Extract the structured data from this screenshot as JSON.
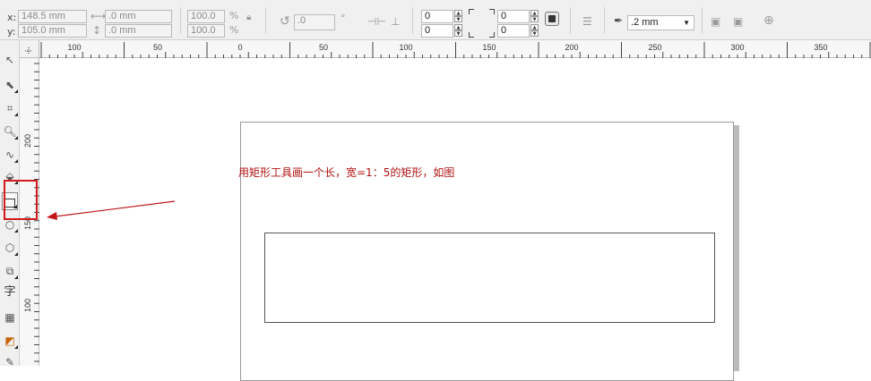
{
  "property_bar": {
    "x_label": "x:",
    "y_label": "y:",
    "x_value": "148.5 mm",
    "y_value": "105.0 mm",
    "width_value": ".0 mm",
    "height_value": ".0 mm",
    "scale_x": "100.0",
    "scale_y": "100.0",
    "percent": "%",
    "rotation_value": ".0",
    "degree": "°",
    "corner_tl": "0",
    "corner_bl": "0",
    "corner_tr": "0",
    "corner_br": "0",
    "outline_width": ".2 mm"
  },
  "ruler": {
    "horizontal": [
      "100",
      "50",
      "0",
      "50",
      "100",
      "150",
      "200",
      "250",
      "300",
      "350"
    ],
    "vertical": [
      "200",
      "150",
      "100"
    ]
  },
  "annotation": {
    "text": "用矩形工具画一个长，宽=1：5的矩形，如图"
  },
  "toolbox": {
    "text_tool_glyph": "字"
  },
  "colors": {
    "annotation": "#b01010",
    "highlight": "#d11a1a"
  }
}
